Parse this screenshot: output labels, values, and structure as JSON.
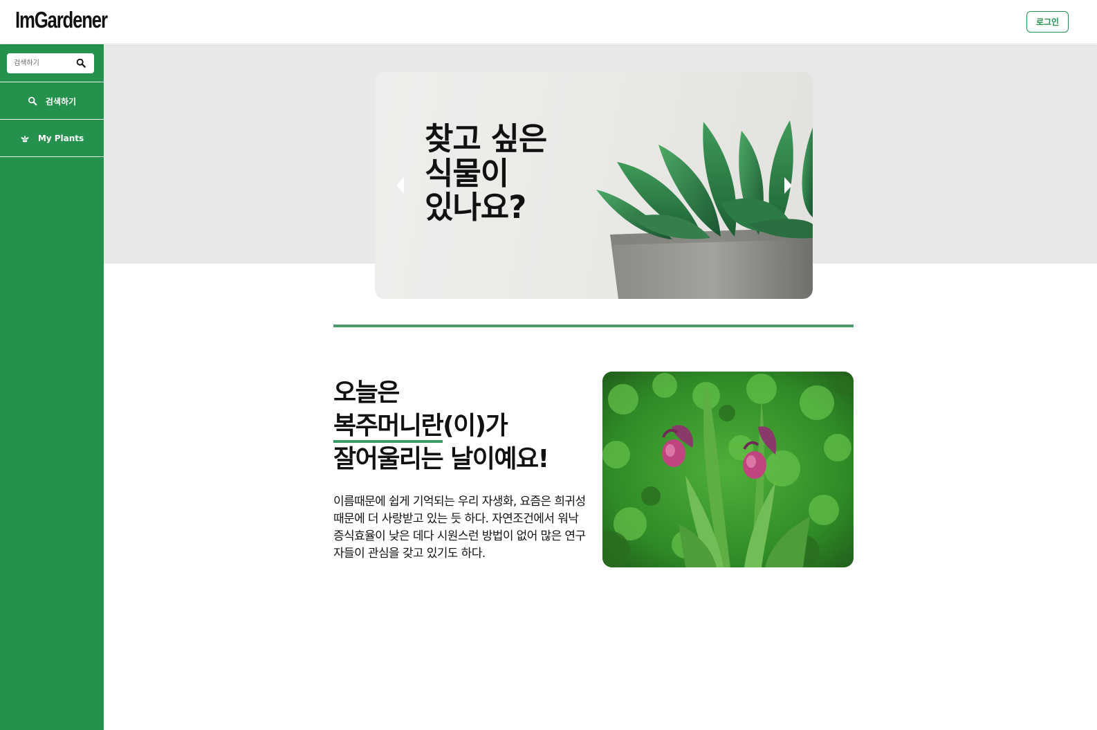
{
  "header": {
    "logo": "ImGardener",
    "login_label": "로그인"
  },
  "sidebar": {
    "search_placeholder": "검색하기",
    "items": [
      {
        "label": "검색하기",
        "icon": "search-icon"
      },
      {
        "label": "My Plants",
        "icon": "plant-icon"
      }
    ]
  },
  "carousel": {
    "title_lines": [
      "찾고 싶은",
      "식물이",
      "있나요?"
    ]
  },
  "today": {
    "line1": "오늘은",
    "plant_name": "복주머니란",
    "line2_suffix": "(이)가",
    "line3": "잘어울리는 날이예요!",
    "description": "이름때문에 쉽게 기억되는 우리 자생화, 요즘은 희귀성 때문에 더 사랑받고 있는 듯 하다. 자연조건에서 워낙 증식효율이 낮은 데다 시원스런 방법이 없어 많은 연구자들이 관심을 갖고 있기도 하다."
  },
  "colors": {
    "brand_green": "#24914d",
    "hero_bg": "#e9e8e8",
    "divider": "#4f9a6c"
  }
}
